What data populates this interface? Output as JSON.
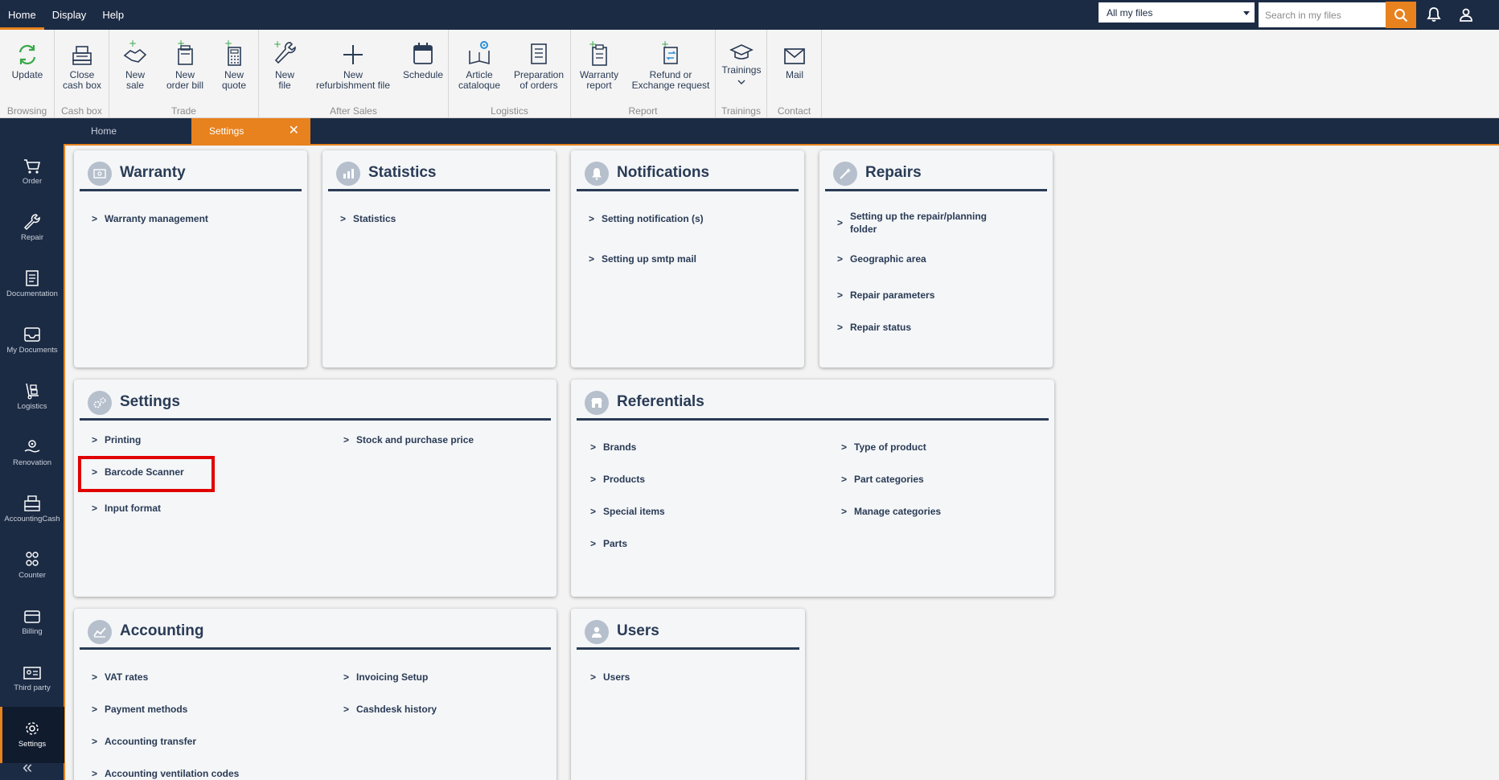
{
  "topmenu": {
    "home": "Home",
    "display": "Display",
    "help": "Help"
  },
  "header": {
    "scope_value": "All my files",
    "search_placeholder": "Search in my files"
  },
  "ribbon": {
    "update": "Update",
    "browsing": "Browsing",
    "close_cash_box": "Close\ncash box",
    "cash_box": "Cash box",
    "new_sale": "New\nsale",
    "new_order_bill": "New\norder bill",
    "new_quote": "New\nquote",
    "trade": "Trade",
    "new_file": "New\nfile",
    "new_refurbishment_file": "New\nrefurbishment file",
    "schedule": "Schedule",
    "after_sales": "After Sales",
    "article_catalogue": "Article\ncataloque",
    "preparation_of_orders": "Preparation\nof orders",
    "logistics": "Logistics",
    "warranty_report": "Warranty\nreport",
    "refund_or_exchange": "Refund or\nExchange request",
    "report": "Report",
    "trainings_btn": "Trainings",
    "trainings": "Trainings",
    "mail": "Mail",
    "contact": "Contact"
  },
  "tabs": {
    "home": "Home",
    "settings": "Settings",
    "close": "✕"
  },
  "nav": {
    "order": "Order",
    "repair": "Repair",
    "documentation": "Documentation",
    "my_documents": "My Documents",
    "logistics": "Logistics",
    "renovation": "Renovation",
    "accounting_cash": "AccountingCash",
    "counter": "Counter",
    "billing": "Billing",
    "third_party": "Third party",
    "settings": "Settings",
    "collapse": "«"
  },
  "cards": {
    "warranty": {
      "title": "Warranty",
      "links": [
        "Warranty management"
      ]
    },
    "statistics": {
      "title": "Statistics",
      "links": [
        "Statistics"
      ]
    },
    "notifications": {
      "title": "Notifications",
      "links": [
        "Setting notification (s)",
        "Setting up smtp mail"
      ]
    },
    "repairs": {
      "title": "Repairs",
      "links": [
        "Setting up the repair/planning folder",
        "Geographic area",
        "Repair parameters",
        "Repair status"
      ]
    },
    "settings": {
      "title": "Settings",
      "links": [
        "Printing",
        "Barcode Scanner",
        "Input format",
        "Stock and purchase price"
      ]
    },
    "referentials": {
      "title": "Referentials",
      "links": [
        "Brands",
        "Products",
        "Special items",
        "Parts",
        "Type of product",
        "Part categories",
        "Manage categories"
      ]
    },
    "accounting": {
      "title": "Accounting",
      "links": [
        "VAT rates",
        "Payment methods",
        "Accounting transfer",
        "Accounting ventilation codes",
        "Invoicing Setup",
        "Cashdesk history"
      ]
    },
    "users": {
      "title": "Users",
      "links": [
        "Users"
      ]
    }
  },
  "chevron": ">",
  "colors": {
    "navy": "#1c2b44",
    "accent": "#e8821e",
    "highlight": "#e00000"
  }
}
